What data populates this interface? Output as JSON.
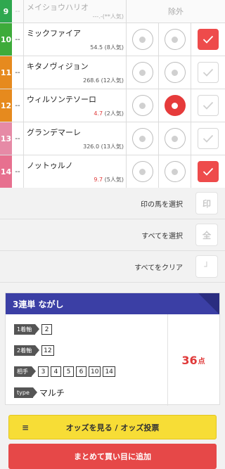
{
  "header_row": {
    "number": "9",
    "mark": "--",
    "name": "メイショウハリオ",
    "odds": "---.-(**人気)",
    "exclude_label": "除外",
    "color": "#2fa84f"
  },
  "horses": [
    {
      "number": "10",
      "mark": "--",
      "name": "ミックファイア",
      "odds": "54.5",
      "pop": "(8人気)",
      "odds_hot": false,
      "color": "#3dab3a",
      "radio1": false,
      "radio2": false,
      "checked": true
    },
    {
      "number": "11",
      "mark": "--",
      "name": "キタノヴィジョン",
      "odds": "268.6",
      "pop": "(12人気)",
      "odds_hot": false,
      "color": "#e68a1e",
      "radio1": false,
      "radio2": false,
      "checked": false
    },
    {
      "number": "12",
      "mark": "--",
      "name": "ウィルソンテソーロ",
      "odds": "4.7",
      "pop": "(2人気)",
      "odds_hot": true,
      "color": "#e68a1e",
      "radio1": false,
      "radio2": true,
      "checked": false
    },
    {
      "number": "13",
      "mark": "--",
      "name": "グランデマーレ",
      "odds": "326.0",
      "pop": "(13人気)",
      "odds_hot": false,
      "color": "#e68aa6",
      "radio1": false,
      "radio2": false,
      "checked": false
    },
    {
      "number": "14",
      "mark": "--",
      "name": "ノットゥルノ",
      "odds": "9.7",
      "pop": "(5人気)",
      "odds_hot": true,
      "color": "#e7708f",
      "radio1": false,
      "radio2": false,
      "checked": true
    }
  ],
  "actions": [
    {
      "label": "印の馬を選択",
      "icon": "印",
      "icon_name": "mark-icon"
    },
    {
      "label": "すべてを選択",
      "icon": "全",
      "icon_name": "all-icon"
    },
    {
      "label": "すべてをクリア",
      "icon": "┘",
      "icon_name": "clear-icon"
    }
  ],
  "summary": {
    "title": "3連単 ながし",
    "legs": [
      {
        "tag": "1着軸",
        "values": [
          "2"
        ]
      },
      {
        "tag": "2着軸",
        "values": [
          "12"
        ]
      },
      {
        "tag": "相手",
        "values": [
          "3",
          "4",
          "5",
          "6",
          "10",
          "14"
        ]
      }
    ],
    "type_tag": "type",
    "type_value": "マルチ",
    "count": "36",
    "count_unit": "点"
  },
  "buttons": {
    "odds": "オッズを見る / オッズ投票",
    "add": "まとめて買い目に追加"
  },
  "colors": {
    "header_blue": "#3b3fa5",
    "accent_red": "#e64848",
    "odds_yellow": "#f7dd36"
  }
}
